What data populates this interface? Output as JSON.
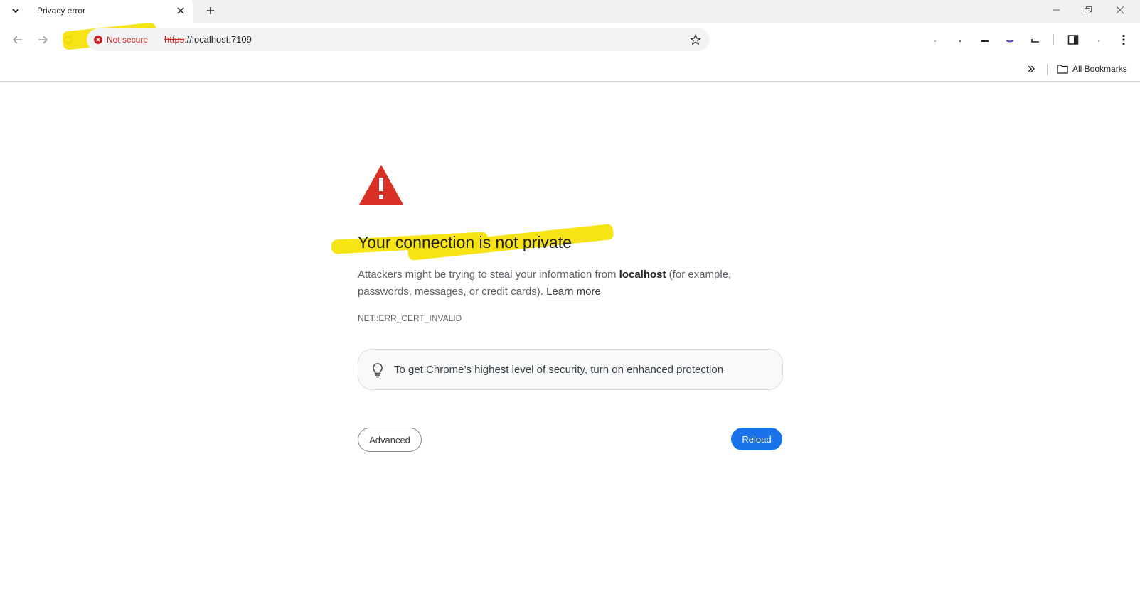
{
  "tab": {
    "title": "Privacy error"
  },
  "omnibox": {
    "security_chip": "Not secure",
    "url_scheme": "https",
    "url_rest": "://localhost:7109"
  },
  "bookmarks_bar": {
    "all_bookmarks_label": "All Bookmarks"
  },
  "interstitial": {
    "headline": "Your connection is not private",
    "desc_part1": "Attackers might be trying to steal your information from ",
    "desc_host": "localhost",
    "desc_part2": " (for example, passwords, messages, or credit cards). ",
    "learn_more": "Learn more",
    "error_code": "NET::ERR_CERT_INVALID",
    "promo_text": "To get Chrome’s highest level of security, ",
    "promo_link": "turn on enhanced protection",
    "advanced_button": "Advanced",
    "reload_button": "Reload"
  },
  "colors": {
    "accent": "#1a73e8",
    "warning_red": "#d93025",
    "highlight_yellow": "#f6e30a"
  },
  "icons": [
    "chevron-down-icon",
    "close-icon",
    "plus-icon",
    "minimize-icon",
    "restore-icon",
    "back-arrow-icon",
    "forward-arrow-icon",
    "reload-icon",
    "error-circle-icon",
    "star-icon",
    "side-panel-icon",
    "kebab-menu-icon",
    "double-chevron-icon",
    "folder-icon",
    "warning-triangle-icon",
    "lightbulb-icon"
  ]
}
